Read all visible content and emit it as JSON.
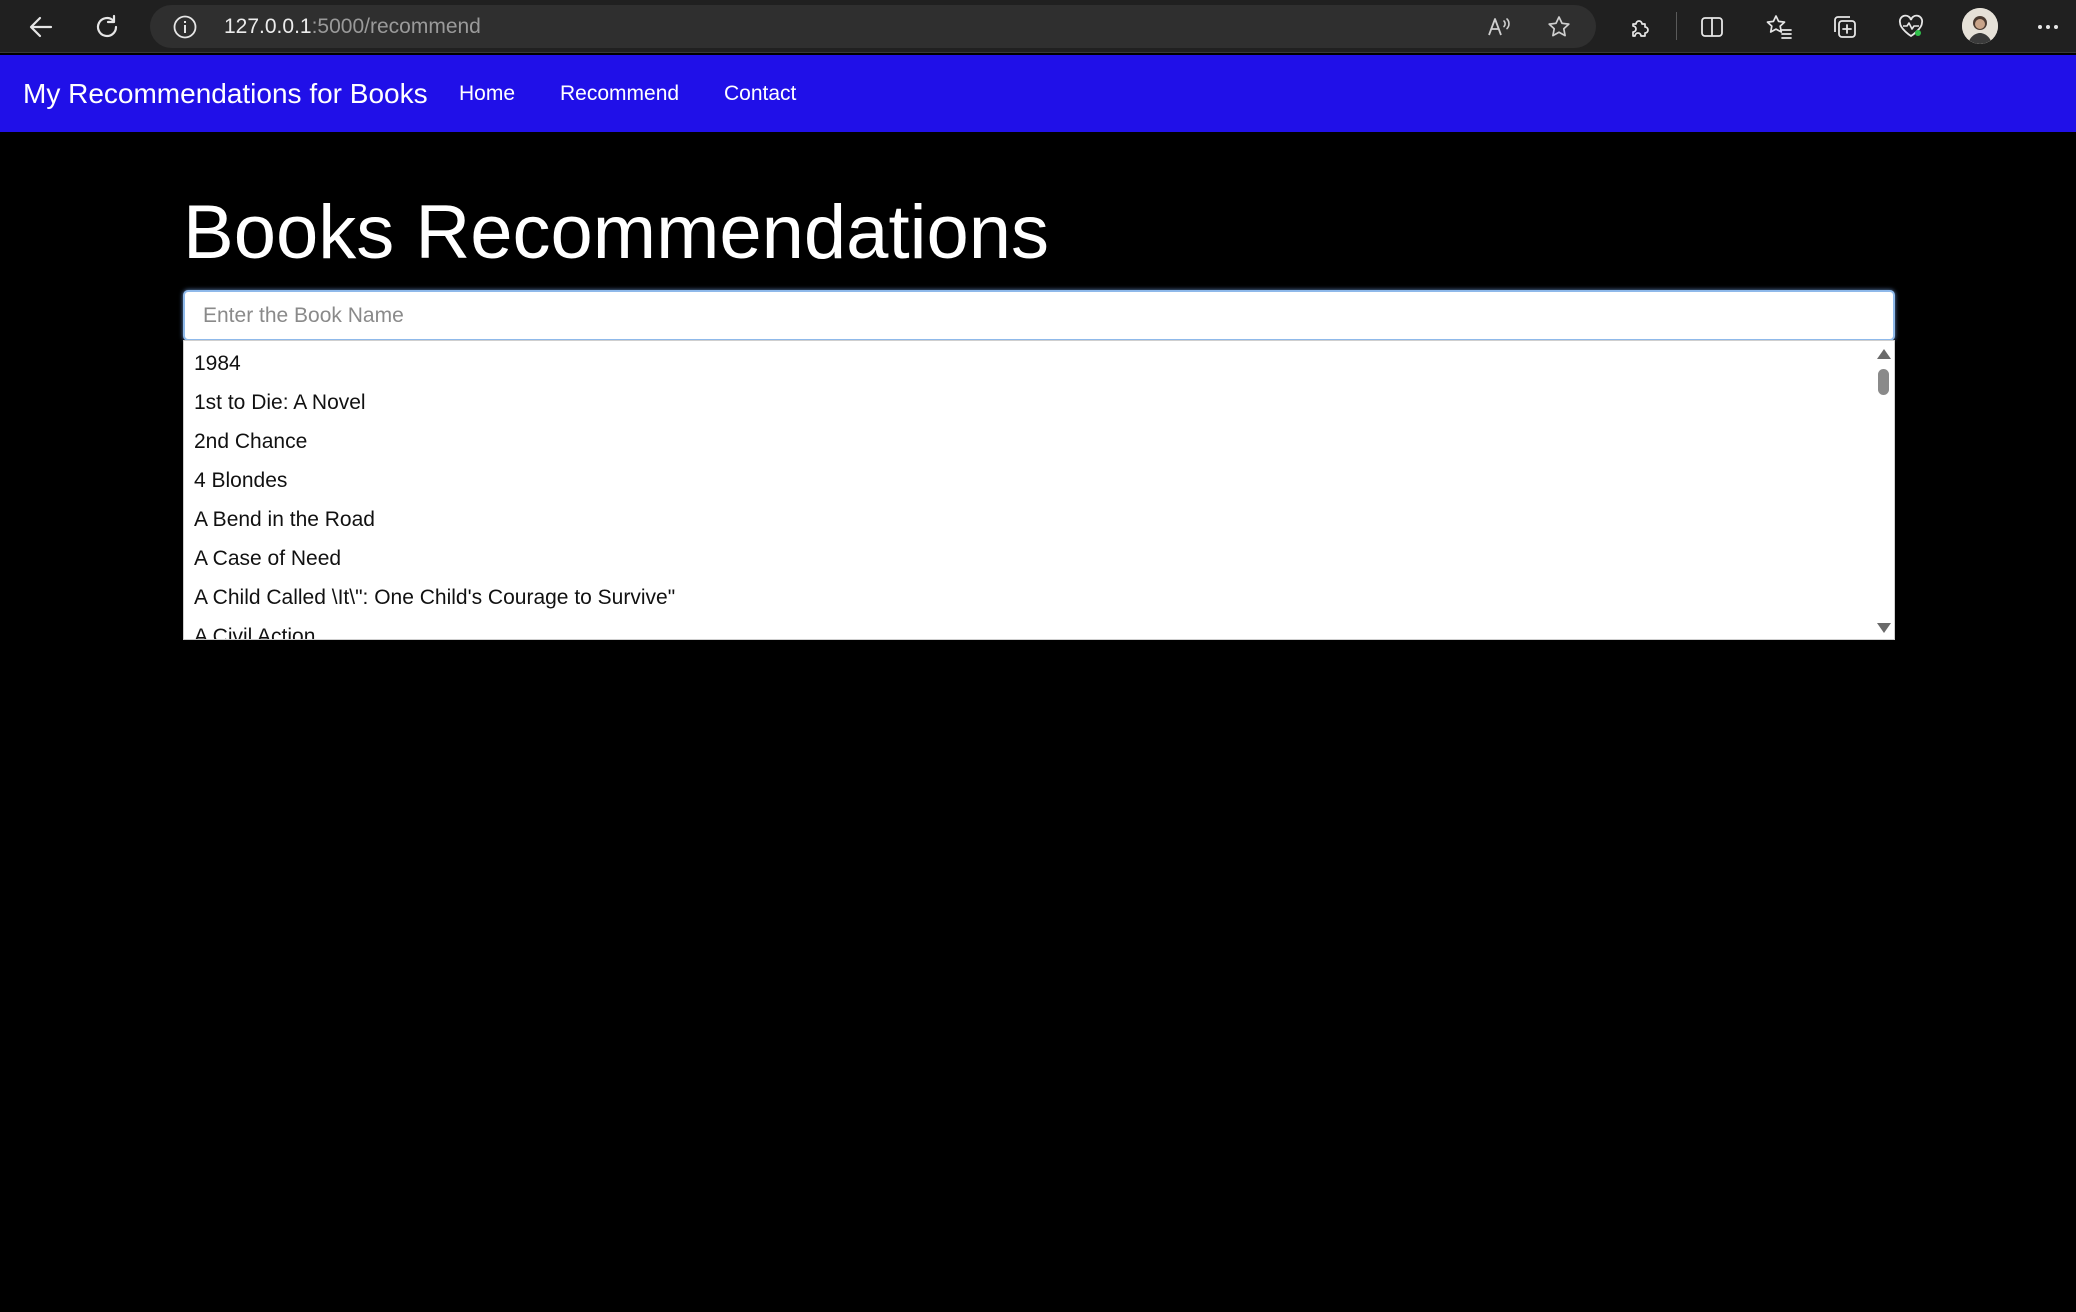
{
  "browser": {
    "url_host": "127.0.0.1",
    "url_path": ":5000/recommend",
    "icons": [
      "back-arrow-icon",
      "reload-icon",
      "site-info-icon",
      "read-aloud-icon",
      "favorite-star-icon",
      "extensions-icon",
      "split-screen-icon",
      "favorites-icon",
      "collections-icon",
      "browser-essentials-icon",
      "profile-avatar",
      "more-menu-icon"
    ]
  },
  "navbar": {
    "brand": "My Recommendations for Books",
    "links": [
      "Home",
      "Recommend",
      "Contact"
    ],
    "color": "#2010e8"
  },
  "main": {
    "title": "Books Recommendations",
    "search_placeholder": "Enter the Book Name",
    "suggestions": [
      "1984",
      "1st to Die: A Novel",
      "2nd Chance",
      "4 Blondes",
      "A Bend in the Road",
      "A Case of Need",
      "A Child Called \\It\\\": One Child's Courage to Survive\"",
      "A Civil Action"
    ]
  }
}
